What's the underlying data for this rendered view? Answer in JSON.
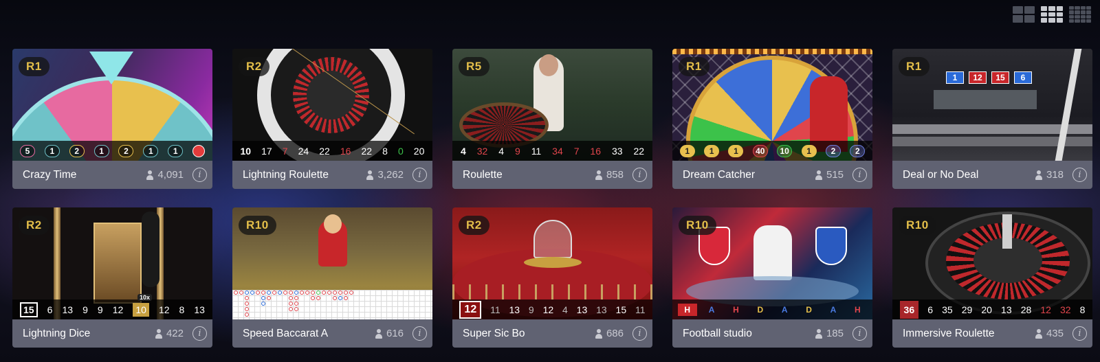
{
  "view_toggles": [
    {
      "name": "view-large-icon",
      "active": false
    },
    {
      "name": "view-medium-icon",
      "active": true
    },
    {
      "name": "view-small-icon",
      "active": false
    }
  ],
  "games": [
    {
      "id": "crazy-time",
      "title": "Crazy Time",
      "round": "R1",
      "players": "4,091",
      "kind": "crazytime",
      "results": [
        {
          "v": "5",
          "c": "#e76aa0"
        },
        {
          "v": "1",
          "c": "#6fc2c8"
        },
        {
          "v": "2",
          "c": "#e8c04e"
        },
        {
          "v": "1",
          "c": "#6fc2c8"
        },
        {
          "v": "2",
          "c": "#e8c04e"
        },
        {
          "v": "1",
          "c": "#6fc2c8"
        },
        {
          "v": "1",
          "c": "#6fc2c8"
        },
        {
          "v": "",
          "c": "#e23b3b"
        }
      ]
    },
    {
      "id": "lightning-roulette",
      "title": "Lightning Roulette",
      "round": "R2",
      "players": "3,262",
      "kind": "roulette",
      "results": [
        {
          "v": "10",
          "c": "white"
        },
        {
          "v": "17",
          "c": "white"
        },
        {
          "v": "7",
          "c": "red"
        },
        {
          "v": "24",
          "c": "white"
        },
        {
          "v": "22",
          "c": "white"
        },
        {
          "v": "16",
          "c": "red"
        },
        {
          "v": "22",
          "c": "white"
        },
        {
          "v": "8",
          "c": "white"
        },
        {
          "v": "0",
          "c": "green"
        },
        {
          "v": "20",
          "c": "white"
        }
      ]
    },
    {
      "id": "roulette",
      "title": "Roulette",
      "round": "R5",
      "players": "858",
      "kind": "dealer",
      "results": [
        {
          "v": "4",
          "c": "white"
        },
        {
          "v": "32",
          "c": "red"
        },
        {
          "v": "4",
          "c": "white"
        },
        {
          "v": "9",
          "c": "red"
        },
        {
          "v": "11",
          "c": "white"
        },
        {
          "v": "34",
          "c": "red"
        },
        {
          "v": "7",
          "c": "red"
        },
        {
          "v": "16",
          "c": "red"
        },
        {
          "v": "33",
          "c": "white"
        },
        {
          "v": "22",
          "c": "white"
        }
      ]
    },
    {
      "id": "dream-catcher",
      "title": "Dream Catcher",
      "round": "R1",
      "players": "515",
      "kind": "wheel",
      "results": [
        {
          "v": "1",
          "c": "#e8c04e"
        },
        {
          "v": "1",
          "c": "#e8c04e"
        },
        {
          "v": "1",
          "c": "#e8c04e"
        },
        {
          "v": "40",
          "c": "#e0454c"
        },
        {
          "v": "10",
          "c": "#3cc24a"
        },
        {
          "v": "1",
          "c": "#e8c04e"
        },
        {
          "v": "2",
          "c": "#6c7cdc"
        },
        {
          "v": "2",
          "c": "#6c7cdc"
        }
      ]
    },
    {
      "id": "deal-or-no-deal",
      "title": "Deal or No Deal",
      "round": "R1",
      "players": "318",
      "kind": "deal",
      "boxes": [
        "1",
        "12",
        "15",
        "6"
      ]
    },
    {
      "id": "lightning-dice",
      "title": "Lightning Dice",
      "round": "R2",
      "players": "422",
      "kind": "dice",
      "results": [
        {
          "v": "15",
          "c": "white"
        },
        {
          "v": "6",
          "c": "white"
        },
        {
          "v": "13",
          "c": "white"
        },
        {
          "v": "9",
          "c": "white"
        },
        {
          "v": "9",
          "c": "white"
        },
        {
          "v": "12",
          "c": "white"
        },
        {
          "v": "10",
          "c": "gold",
          "tag": "10x"
        },
        {
          "v": "12",
          "c": "white"
        },
        {
          "v": "8",
          "c": "white"
        },
        {
          "v": "13",
          "c": "white"
        }
      ]
    },
    {
      "id": "speed-baccarat-a",
      "title": "Speed Baccarat A",
      "round": "R10",
      "players": "616",
      "kind": "baccarat"
    },
    {
      "id": "super-sic-bo",
      "title": "Super Sic Bo",
      "round": "R2",
      "players": "686",
      "kind": "sicbo",
      "results": [
        {
          "v": "12",
          "c": "red"
        },
        {
          "v": "11",
          "c": "white"
        },
        {
          "v": "13",
          "c": "white"
        },
        {
          "v": "9",
          "c": "white"
        },
        {
          "v": "12",
          "c": "white"
        },
        {
          "v": "4",
          "c": "white"
        },
        {
          "v": "13",
          "c": "white"
        },
        {
          "v": "13",
          "c": "white"
        },
        {
          "v": "15",
          "c": "white"
        },
        {
          "v": "11",
          "c": "white"
        }
      ]
    },
    {
      "id": "football-studio",
      "title": "Football studio",
      "round": "R10",
      "players": "185",
      "kind": "football",
      "results": [
        {
          "v": "H",
          "c": "red"
        },
        {
          "v": "A",
          "c": "blue"
        },
        {
          "v": "H",
          "c": "red"
        },
        {
          "v": "D",
          "c": "gold"
        },
        {
          "v": "A",
          "c": "blue"
        },
        {
          "v": "D",
          "c": "gold"
        },
        {
          "v": "A",
          "c": "blue"
        },
        {
          "v": "H",
          "c": "red"
        }
      ]
    },
    {
      "id": "immersive-roulette",
      "title": "Immersive Roulette",
      "round": "R10",
      "players": "435",
      "kind": "immersive",
      "results": [
        {
          "v": "36",
          "c": "red"
        },
        {
          "v": "6",
          "c": "white"
        },
        {
          "v": "35",
          "c": "white"
        },
        {
          "v": "29",
          "c": "white"
        },
        {
          "v": "20",
          "c": "white"
        },
        {
          "v": "13",
          "c": "white"
        },
        {
          "v": "28",
          "c": "white"
        },
        {
          "v": "12",
          "c": "red"
        },
        {
          "v": "32",
          "c": "red"
        },
        {
          "v": "8",
          "c": "white"
        }
      ]
    }
  ]
}
